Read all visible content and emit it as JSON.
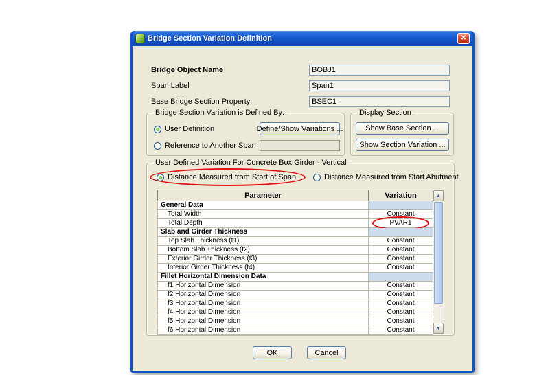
{
  "window": {
    "title": "Bridge Section Variation Definition",
    "close_glyph": "✕"
  },
  "fields": [
    {
      "label": "Bridge Object Name",
      "value": "BOBJ1"
    },
    {
      "label": "Span Label",
      "value": "Span1"
    },
    {
      "label": "Base Bridge Section Property",
      "value": "BSEC1"
    }
  ],
  "defined_by": {
    "title": "Bridge Section Variation is Defined By:",
    "radio_user_definition": "User Definition",
    "radio_reference": "Reference to Another Span",
    "define_show_button": "Define/Show Variations ...",
    "reference_value": ""
  },
  "display_section": {
    "title": "Display Section",
    "show_base_button": "Show Base Section ...",
    "show_variation_button": "Show Section Variation ..."
  },
  "variation": {
    "title": "User Defined Variation For Concrete Box Girder - Vertical",
    "radio_start_of_span": "Distance Measured from Start of Span",
    "radio_start_abutment": "Distance Measured from Start Abutment",
    "table": {
      "columns": [
        "Parameter",
        "Variation"
      ],
      "rows": [
        {
          "type": "section",
          "label": "General Data",
          "variation": ""
        },
        {
          "type": "item",
          "label": "Total Width",
          "variation": "Constant"
        },
        {
          "type": "item",
          "label": "Total Depth",
          "variation": "PVAR1",
          "circled": true
        },
        {
          "type": "section",
          "label": "Slab and Girder Thickness",
          "variation": ""
        },
        {
          "type": "item",
          "label": "Top Slab Thickness (t1)",
          "variation": "Constant"
        },
        {
          "type": "item",
          "label": "Bottom Slab Thickness (t2)",
          "variation": "Constant"
        },
        {
          "type": "item",
          "label": "Exterior Girder Thickness (t3)",
          "variation": "Constant"
        },
        {
          "type": "item",
          "label": "Interior Girder Thickness (t4)",
          "variation": "Constant"
        },
        {
          "type": "section",
          "label": "Fillet Horizontal Dimension Data",
          "variation": ""
        },
        {
          "type": "item",
          "label": "f1 Horizontal Dimension",
          "variation": "Constant"
        },
        {
          "type": "item",
          "label": "f2 Horizontal Dimension",
          "variation": "Constant"
        },
        {
          "type": "item",
          "label": "f3 Horizontal Dimension",
          "variation": "Constant"
        },
        {
          "type": "item",
          "label": "f4 Horizontal Dimension",
          "variation": "Constant"
        },
        {
          "type": "item",
          "label": "f5 Horizontal Dimension",
          "variation": "Constant"
        },
        {
          "type": "item",
          "label": "f6 Horizontal Dimension",
          "variation": "Constant"
        }
      ]
    }
  },
  "icons": {
    "scroll_up": "▲",
    "scroll_down": "▼"
  },
  "footer": {
    "ok": "OK",
    "cancel": "Cancel"
  },
  "colors": {
    "titlebar_blue": "#1458cc",
    "dialog_face": "#ece9d8",
    "annotation_red": "#e01010",
    "section_row_blue": "#ccdcee"
  }
}
